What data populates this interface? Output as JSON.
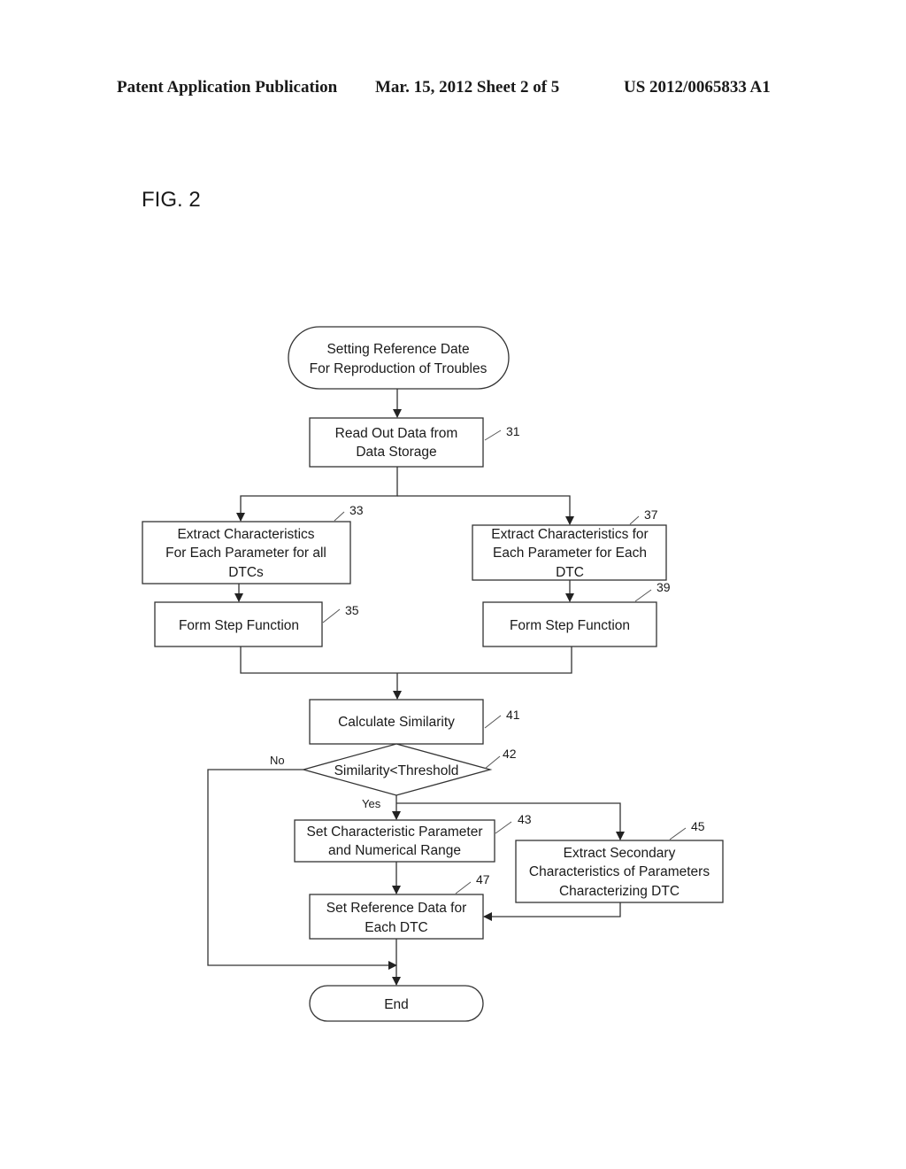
{
  "header": {
    "publication_type": "Patent Application Publication",
    "date_sheet": "Mar. 15, 2012  Sheet 2 of 5",
    "patent_number": "US 2012/0065833 A1"
  },
  "figure": {
    "label": "FIG. 2"
  },
  "flowchart": {
    "start": {
      "lines": [
        "Setting Reference Date",
        "For Reproduction of Troubles"
      ]
    },
    "read_data": {
      "lines": [
        "Read Out Data from",
        "Data Storage"
      ],
      "ref": "31"
    },
    "extract_all": {
      "lines": [
        "Extract Characteristics",
        "For Each Parameter for all",
        "DTCs"
      ],
      "ref": "33"
    },
    "step_left": {
      "lines": [
        "Form Step Function"
      ],
      "ref": "35"
    },
    "extract_each": {
      "lines": [
        "Extract Characteristics for",
        "Each Parameter for Each",
        "DTC"
      ],
      "ref": "37"
    },
    "step_right": {
      "lines": [
        "Form Step Function"
      ],
      "ref": "39"
    },
    "calc_similarity": {
      "lines": [
        "Calculate Similarity"
      ],
      "ref": "41"
    },
    "decision": {
      "lines": [
        "Similarity<Threshold"
      ],
      "ref": "42",
      "no_label": "No",
      "yes_label": "Yes"
    },
    "set_param": {
      "lines": [
        "Set Characteristic Parameter",
        "and Numerical Range"
      ],
      "ref": "43"
    },
    "extract_secondary": {
      "lines": [
        "Extract Secondary",
        "Characteristics of Parameters",
        "Characterizing DTC"
      ],
      "ref": "45"
    },
    "set_reference": {
      "lines": [
        "Set Reference Data for",
        "Each DTC"
      ],
      "ref": "47"
    },
    "end": {
      "lines": [
        "End"
      ]
    }
  }
}
